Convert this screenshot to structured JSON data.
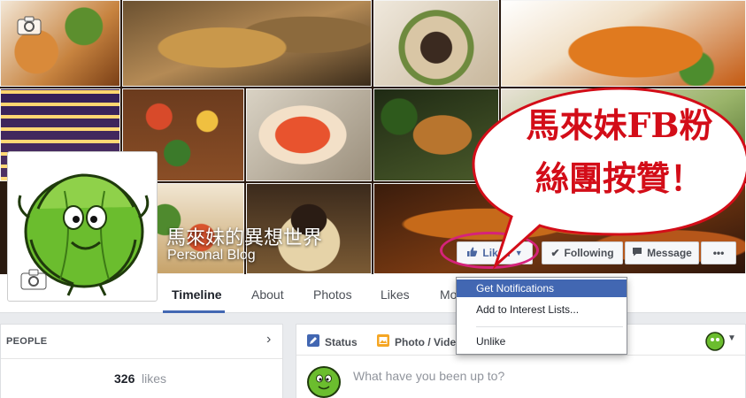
{
  "page": {
    "name": "馬來妹的異想世界",
    "category": "Personal Blog"
  },
  "cover": {
    "tiles": [
      "food-photo",
      "food-photo",
      "food-photo",
      "food-photo",
      "food-photo",
      "food-photo",
      "food-photo",
      "food-photo",
      "food-photo",
      "food-photo",
      "food-photo",
      "food-photo"
    ]
  },
  "actions": {
    "liked": "Liked",
    "following": "Following",
    "message": "Message",
    "more": "•••"
  },
  "bubble": {
    "line1": "馬來妹FB粉",
    "line2": "絲團按贊！"
  },
  "tabs": [
    "Timeline",
    "About",
    "Photos",
    "Likes",
    "Mo"
  ],
  "dropdown": {
    "items": [
      "Get Notifications",
      "Add to Interest Lists...",
      "Unlike"
    ],
    "active_index": 0
  },
  "people": {
    "header": "PEOPLE",
    "likes_count": "326",
    "likes_label": "likes"
  },
  "composer": {
    "status_label": "Status",
    "photo_label": "Photo / Vide",
    "placeholder": "What have you been up to?"
  },
  "colors": {
    "facebook_blue": "#4267b2",
    "highlight_ring": "#d6237a",
    "bubble_text": "#d30d18"
  },
  "icons": {
    "liked": "thumbs-up-icon",
    "following": "checkmark-icon",
    "message": "speech-icon",
    "camera": "camera-icon",
    "status": "pencil-icon",
    "photo": "photo-icon",
    "chevron": "chevron-right-icon"
  }
}
